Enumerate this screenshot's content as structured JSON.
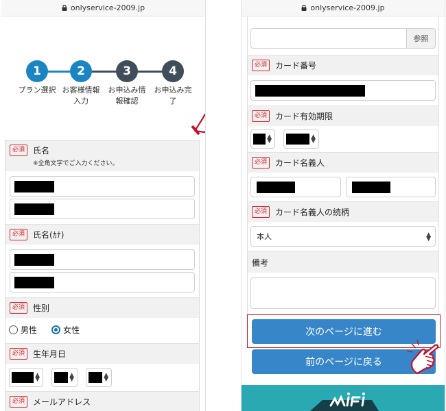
{
  "left": {
    "url": "onlyservice-2009.jp",
    "steps": [
      {
        "num": "1",
        "line1": "プラン選択",
        "line2": ""
      },
      {
        "num": "2",
        "line1": "お客様情報",
        "line2": "入力"
      },
      {
        "num": "3",
        "line1": "お申込み情",
        "line2": "報確認"
      },
      {
        "num": "4",
        "line1": "お申込み完",
        "line2": "了"
      }
    ],
    "required_label": "必須",
    "fields": {
      "name_label": "氏名",
      "name_note": "※全角文字でご入力ください。",
      "kana_label": "氏名(ｶﾅ)",
      "gender_label": "性別",
      "gender_male": "男性",
      "gender_female": "女性",
      "birth_label": "生年月日",
      "email_label": "メールアドレス"
    }
  },
  "right": {
    "url": "onlyservice-2009.jp",
    "ref_button": "参照",
    "required_label": "必須",
    "fields": {
      "card_number_label": "カード番号",
      "card_expiry_label": "カード有効期限",
      "card_holder_label": "カード名義人",
      "relation_label": "カード名義人の続柄",
      "relation_value": "本人",
      "notes_label": "備考"
    },
    "next_button": "次のページに進む",
    "prev_button": "前のページに戻る"
  },
  "colors": {
    "step_active": "#1b85c4",
    "step_inactive": "#3f4e5a",
    "required": "#d7262c",
    "primary_button": "#3686c9",
    "highlight": "#c21f2a",
    "pointer_hand": "#c8102e",
    "banner": "#2aa9b3"
  },
  "icons": {
    "lock": "lock-icon",
    "pointer": "pointing-hand-icon",
    "select": "select-arrows-icon"
  }
}
